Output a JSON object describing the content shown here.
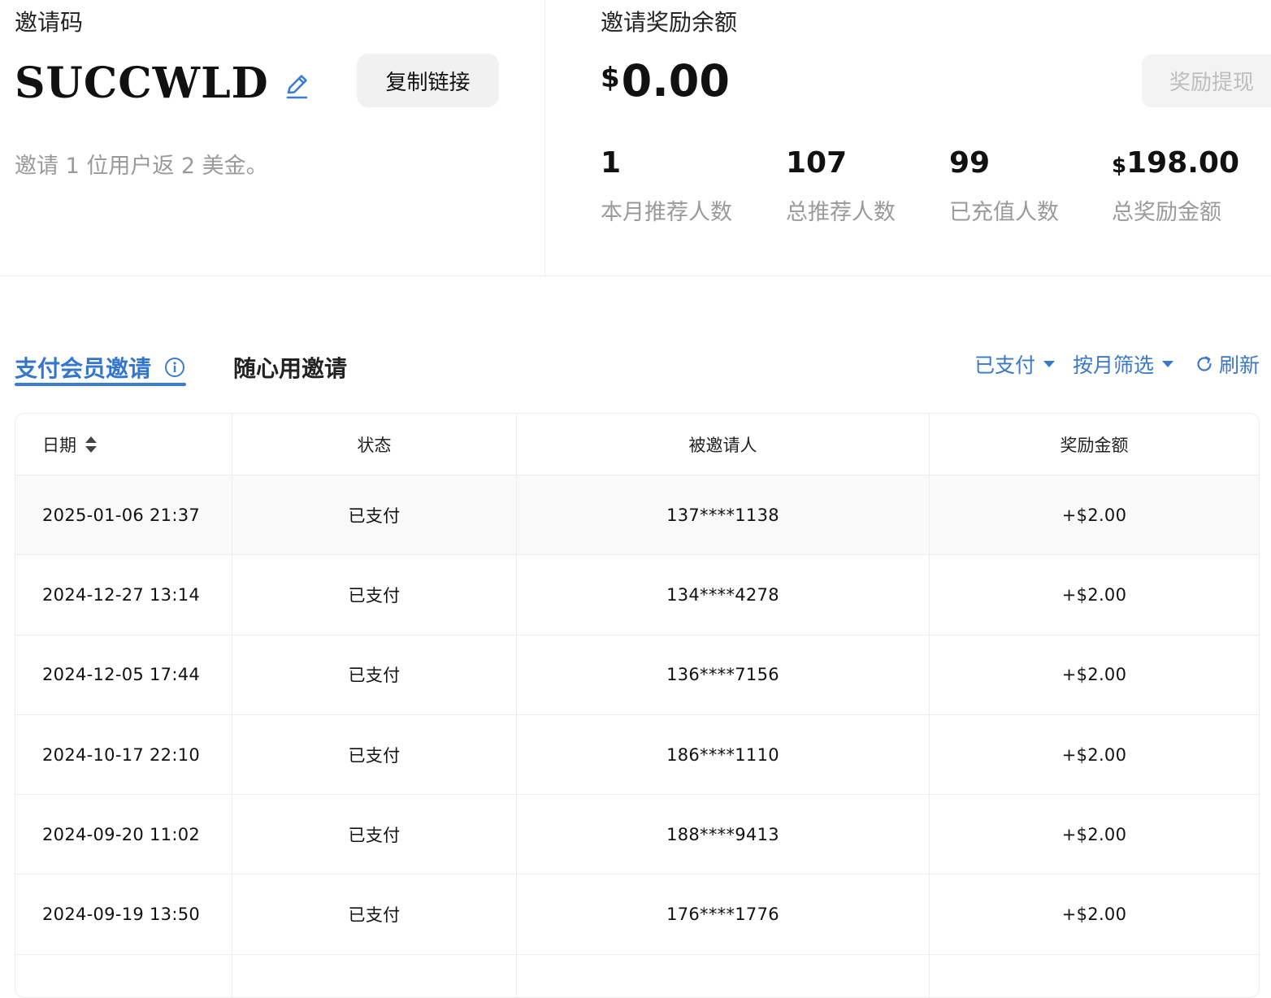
{
  "invite": {
    "label": "邀请码",
    "code": "SUCCWLD",
    "copy_label": "复制链接",
    "desc": "邀请 1 位用户返 2 美金。"
  },
  "balance": {
    "label": "邀请奖励余额",
    "currency": "$",
    "amount": "0.00",
    "withdraw_label": "奖励提现"
  },
  "stats": [
    {
      "currency": "",
      "value": "1",
      "label": "本月推荐人数"
    },
    {
      "currency": "",
      "value": "107",
      "label": "总推荐人数"
    },
    {
      "currency": "",
      "value": "99",
      "label": "已充值人数"
    },
    {
      "currency": "$",
      "value": "198.00",
      "label": "总奖励金额"
    }
  ],
  "tabs": {
    "paid": "支付会员邀请",
    "free": "随心用邀请"
  },
  "filters": {
    "status": "已支付",
    "month": "按月筛选",
    "refresh": "刷新"
  },
  "table": {
    "headers": [
      "日期",
      "状态",
      "被邀请人",
      "奖励金额"
    ],
    "rows": [
      [
        "2025-01-06 21:37",
        "已支付",
        "137****1138",
        "+$2.00"
      ],
      [
        "2024-12-27 13:14",
        "已支付",
        "134****4278",
        "+$2.00"
      ],
      [
        "2024-12-05 17:44",
        "已支付",
        "136****7156",
        "+$2.00"
      ],
      [
        "2024-10-17 22:10",
        "已支付",
        "186****1110",
        "+$2.00"
      ],
      [
        "2024-09-20 11:02",
        "已支付",
        "188****9413",
        "+$2.00"
      ],
      [
        "2024-09-19 13:50",
        "已支付",
        "176****1776",
        "+$2.00"
      ]
    ]
  },
  "colors": {
    "accent": "#3a7bd5",
    "muted": "#9a9a9a",
    "border": "#ececec"
  }
}
